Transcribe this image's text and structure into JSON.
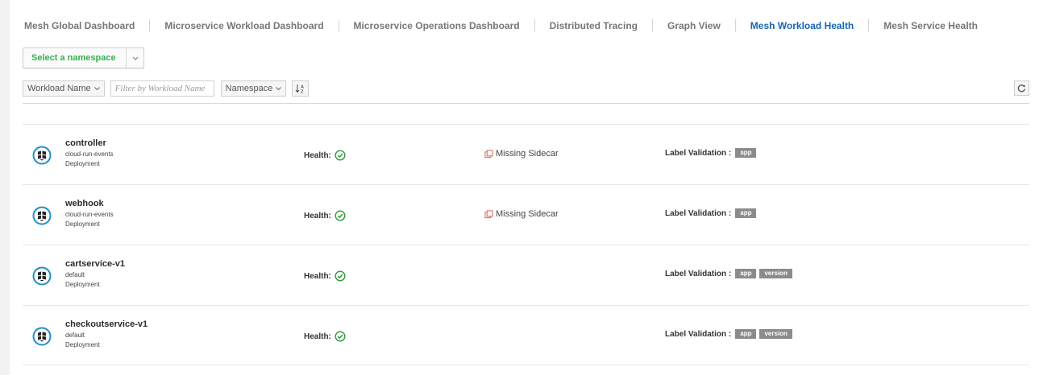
{
  "tabs": [
    {
      "label": "Mesh Global Dashboard"
    },
    {
      "label": "Microservice Workload Dashboard"
    },
    {
      "label": "Microservice Operations Dashboard"
    },
    {
      "label": "Distributed Tracing"
    },
    {
      "label": "Graph View"
    },
    {
      "label": "Mesh Workload Health",
      "active": true
    },
    {
      "label": "Mesh Service Health"
    }
  ],
  "namespace_select": {
    "label": "Select a namespace",
    "icon": "chevron-down-icon"
  },
  "toolbar": {
    "field_dropdown": "Workload Name",
    "filter_placeholder": "Filter by Workload Name",
    "namespace_dropdown": "Namespace",
    "sort_icon": "sort-alpha-icon",
    "refresh_icon": "refresh-icon"
  },
  "colors": {
    "active_tab": "#1565b6",
    "namespace_label": "#2fb34c",
    "health_ok": "#2e9b3a",
    "sidecar_warning": "#d9534f",
    "workload_icon": "#1e8fc8",
    "label_badge": "#8b8b8b"
  },
  "workloads": [
    {
      "name": "controller",
      "namespace": "cloud-run-events",
      "type": "Deployment",
      "health_label": "Health:",
      "health_icon": "check-circle-icon",
      "sidecar": "Missing Sidecar",
      "labels_title": "Label Validation :",
      "labels": [
        "app"
      ]
    },
    {
      "name": "webhook",
      "namespace": "cloud-run-events",
      "type": "Deployment",
      "health_label": "Health:",
      "health_icon": "check-circle-icon",
      "sidecar": "Missing Sidecar",
      "labels_title": "Label Validation :",
      "labels": [
        "app"
      ]
    },
    {
      "name": "cartservice-v1",
      "namespace": "default",
      "type": "Deployment",
      "health_label": "Health:",
      "health_icon": "check-circle-icon",
      "sidecar": "",
      "labels_title": "Label Validation :",
      "labels": [
        "app",
        "version"
      ]
    },
    {
      "name": "checkoutservice-v1",
      "namespace": "default",
      "type": "Deployment",
      "health_label": "Health:",
      "health_icon": "check-circle-icon",
      "sidecar": "",
      "labels_title": "Label Validation :",
      "labels": [
        "app",
        "version"
      ]
    }
  ]
}
